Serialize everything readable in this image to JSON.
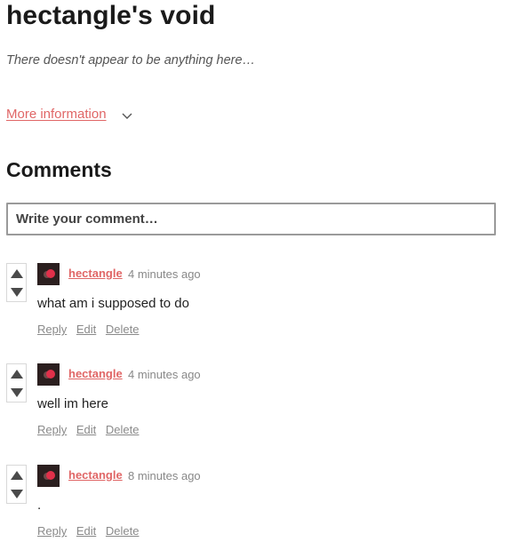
{
  "page": {
    "title": "hectangle's void",
    "subtitle": "There doesn't appear to be anything here…",
    "more_info_label": "More information"
  },
  "comments_section": {
    "heading": "Comments",
    "input_placeholder": "Write your comment…",
    "input_value": ""
  },
  "comments": [
    {
      "username": "hectangle",
      "time": "4 minutes ago",
      "text": "what am i supposed to do",
      "actions": {
        "reply": "Reply",
        "edit": "Edit",
        "delete": "Delete"
      }
    },
    {
      "username": "hectangle",
      "time": "4 minutes ago",
      "text": "well im here",
      "actions": {
        "reply": "Reply",
        "edit": "Edit",
        "delete": "Delete"
      }
    },
    {
      "username": "hectangle",
      "time": "8 minutes ago",
      "text": ".",
      "actions": {
        "reply": "Reply",
        "edit": "Edit",
        "delete": "Delete"
      }
    }
  ],
  "icons": {
    "expand": "chevron-down-icon",
    "upvote": "triangle-up-icon",
    "downvote": "triangle-down-icon"
  },
  "colors": {
    "accent": "#e06666",
    "muted": "#8a8a8a",
    "avatar_bg": "#2b1f1f",
    "avatar_dot": "#e0304a"
  }
}
